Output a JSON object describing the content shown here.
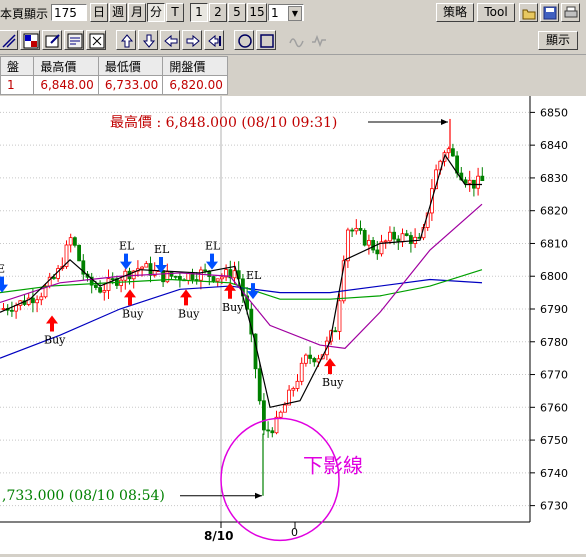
{
  "toolbar": {
    "page_display_label": "本頁顯示",
    "page_count_value": "175",
    "period_buttons": [
      "日",
      "週",
      "月",
      "分",
      "T"
    ],
    "interval_buttons": [
      "1",
      "2",
      "5",
      "15"
    ],
    "interval_select_value": "1",
    "strategy_button": "策略",
    "tool_button": "Tool",
    "display_button": "顯示"
  },
  "table": {
    "headers": [
      "盤",
      "最高價",
      "最低價",
      "開盤價"
    ],
    "values": [
      "1",
      "6,848.00",
      "6,733.00",
      "6,820.00"
    ]
  },
  "chart_data": {
    "type": "candlestick",
    "y_ticks": [
      "6850",
      "6840",
      "6830",
      "6820",
      "6810",
      "6800",
      "6790",
      "6780",
      "6770",
      "6760",
      "6750",
      "6740",
      "6730"
    ],
    "ylim": [
      6725,
      6855
    ],
    "x_date_label": "8/10",
    "x_minor_label": "0",
    "annotation_high": "最高價 : 6,848.000 (08/10 09:31)",
    "annotation_low": ",733.000 (08/10 08:54)",
    "circle_label": "下影線",
    "signals": [
      {
        "kind": "buy",
        "label": "Buy"
      },
      {
        "kind": "buy",
        "label": "Buy"
      },
      {
        "kind": "buy",
        "label": "Buy"
      },
      {
        "kind": "buy",
        "label": "Buy"
      },
      {
        "kind": "buy",
        "label": "Buy"
      },
      {
        "kind": "el",
        "label": "EL"
      },
      {
        "kind": "el",
        "label": "EL"
      },
      {
        "kind": "el",
        "label": "EL"
      },
      {
        "kind": "el",
        "label": "EL"
      },
      {
        "kind": "el",
        "label": "E"
      }
    ],
    "colors": {
      "up": "#ff0000",
      "down": "#008000",
      "ma_short": "#000000",
      "ma_mid": "#00a000",
      "ma_long": "#0000c0",
      "ma_purple": "#a000a0",
      "circle": "#e000e0"
    }
  }
}
